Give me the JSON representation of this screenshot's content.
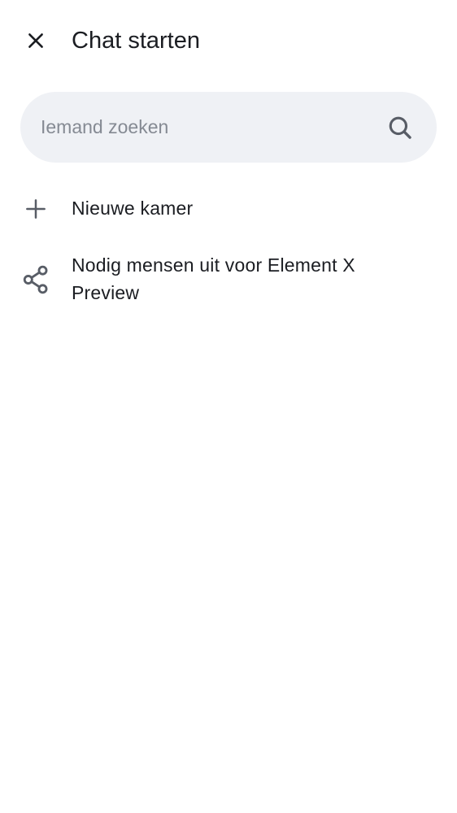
{
  "header": {
    "title": "Chat starten",
    "close_icon": "close-icon"
  },
  "search": {
    "placeholder": "Iemand zoeken",
    "value": "",
    "icon": "search-icon"
  },
  "actions": [
    {
      "label": "Nieuwe kamer",
      "icon": "plus-icon"
    },
    {
      "label": "Nodig mensen uit voor Element X Preview",
      "icon": "share-icon"
    }
  ],
  "colors": {
    "text": "#1b1d22",
    "icon": "#585d66",
    "search_bg": "#eff1f5",
    "placeholder": "#858a93"
  }
}
